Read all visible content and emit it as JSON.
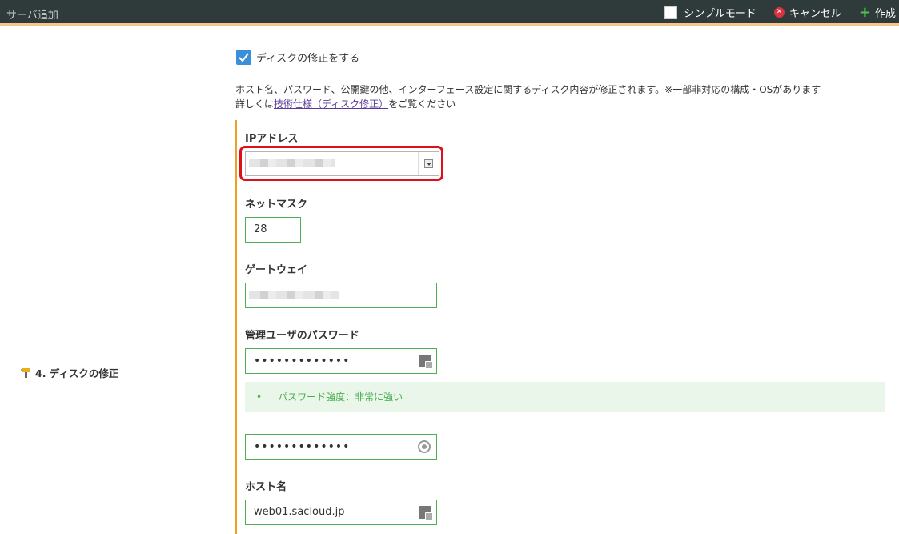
{
  "header": {
    "title": "サーバ追加",
    "simple_mode_label": "シンプルモード",
    "cancel_label": "キャンセル",
    "create_label": "作成"
  },
  "section": {
    "label": "4. ディスクの修正",
    "icon": "tool-icon"
  },
  "disk_edit": {
    "checkbox_label": "ディスクの修正をする",
    "checked": true,
    "description_line1": "ホスト名、パスワード、公開鍵の他、インターフェース設定に関するディスク内容が修正されます。※一部非対応の構成・OSがあります",
    "description_prefix": "詳しくは",
    "description_link": "技術仕様（ディスク修正）",
    "description_suffix": "をご覧ください"
  },
  "form": {
    "ip_label": "IPアドレス",
    "netmask_label": "ネットマスク",
    "netmask_value": "28",
    "gateway_label": "ゲートウェイ",
    "password_label": "管理ユーザのパスワード",
    "password_value": "•••••••••••••",
    "password_strength": "パスワード強度：非常に強い",
    "password_confirm_value": "•••••••••••••",
    "hostname_label": "ホスト名",
    "hostname_value": "web01.sacloud.jp"
  },
  "colors": {
    "header_bg": "#2f3a3a",
    "accent_orange": "#f0a020",
    "field_border": "#4caf50",
    "highlight_red": "#e0101a",
    "checkbox_blue": "#3a8fd8"
  }
}
